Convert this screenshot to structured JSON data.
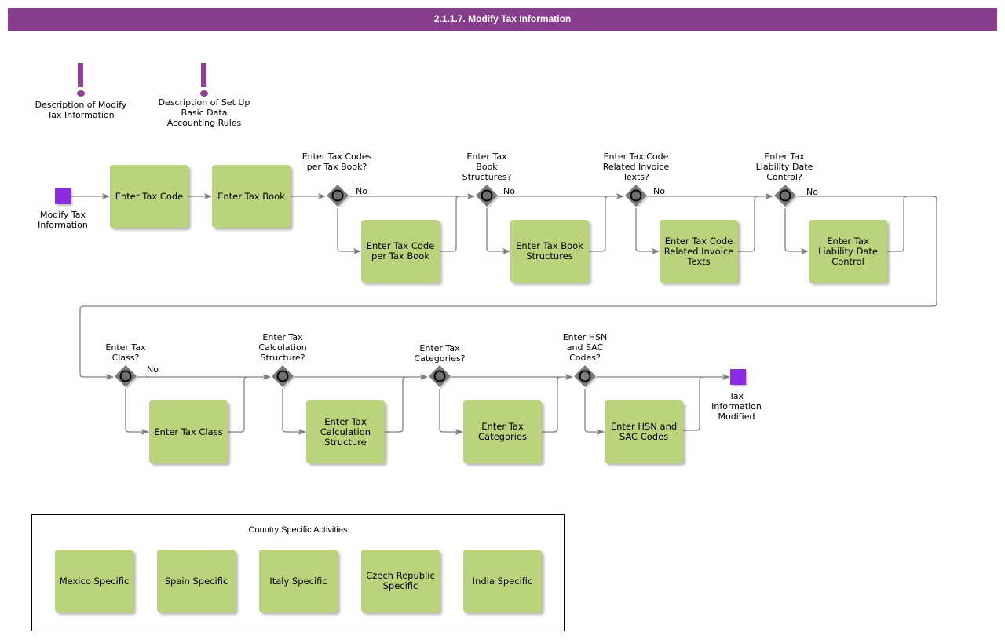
{
  "title": "2.1.1.7. Modify Tax Information",
  "annotations": [
    {
      "label": "Description of Modify Tax Information",
      "lines": [
        "Description of Modify",
        "Tax Information"
      ]
    },
    {
      "label": "Description of Set Up Basic Data Accounting Rules",
      "lines": [
        "Description of Set Up",
        "Basic Data",
        "Accounting Rules"
      ]
    }
  ],
  "events": {
    "start": {
      "label": "Modify Tax Information",
      "color": "#8a2be2"
    },
    "end": {
      "label": "Tax Information Modified",
      "color": "#8a2be2"
    }
  },
  "tasks": {
    "enter_tax_code": "Enter Tax Code",
    "enter_tax_book": "Enter Tax Book",
    "enter_tax_code_per_tax_book": "Enter Tax Code per Tax Book",
    "enter_tax_book_structures": "Enter Tax Book Structures",
    "enter_tax_code_related_invoice_texts": "Enter Tax Code Related Invoice Texts",
    "enter_tax_liability_date_control": "Enter Tax Liability Date Control",
    "enter_tax_class": "Enter Tax Class",
    "enter_tax_calculation_structure": "Enter Tax Calculation Structure",
    "enter_tax_categories": "Enter Tax Categories",
    "enter_hsn_and_sac_codes": "Enter HSN and SAC Codes"
  },
  "gateways": {
    "g1": "Enter Tax Codes per Tax Book?",
    "g2": "Enter Tax Book Structures?",
    "g3": "Enter Tax Code Related Invoice Texts?",
    "g4": "Enter Tax Liability Date Control?",
    "g5": "Enter Tax Class?",
    "g6": "Enter Tax Calculation Structure?",
    "g7": "Enter Tax Categories?",
    "g8": "Enter HSN and SAC Codes?"
  },
  "no_label": "No",
  "country_group": {
    "title": "Country Specific Activities",
    "items": [
      "Mexico Specific",
      "Spain Specific",
      "Italy Specific",
      "Czech Republic Specific",
      "India Specific"
    ]
  },
  "colors": {
    "title_bar": "#863e8c",
    "task_fill": "#bcd37d",
    "gateway_fill": "#7a7a7a",
    "connector": "#7f7f7f",
    "annotation": "#8e3f93"
  }
}
